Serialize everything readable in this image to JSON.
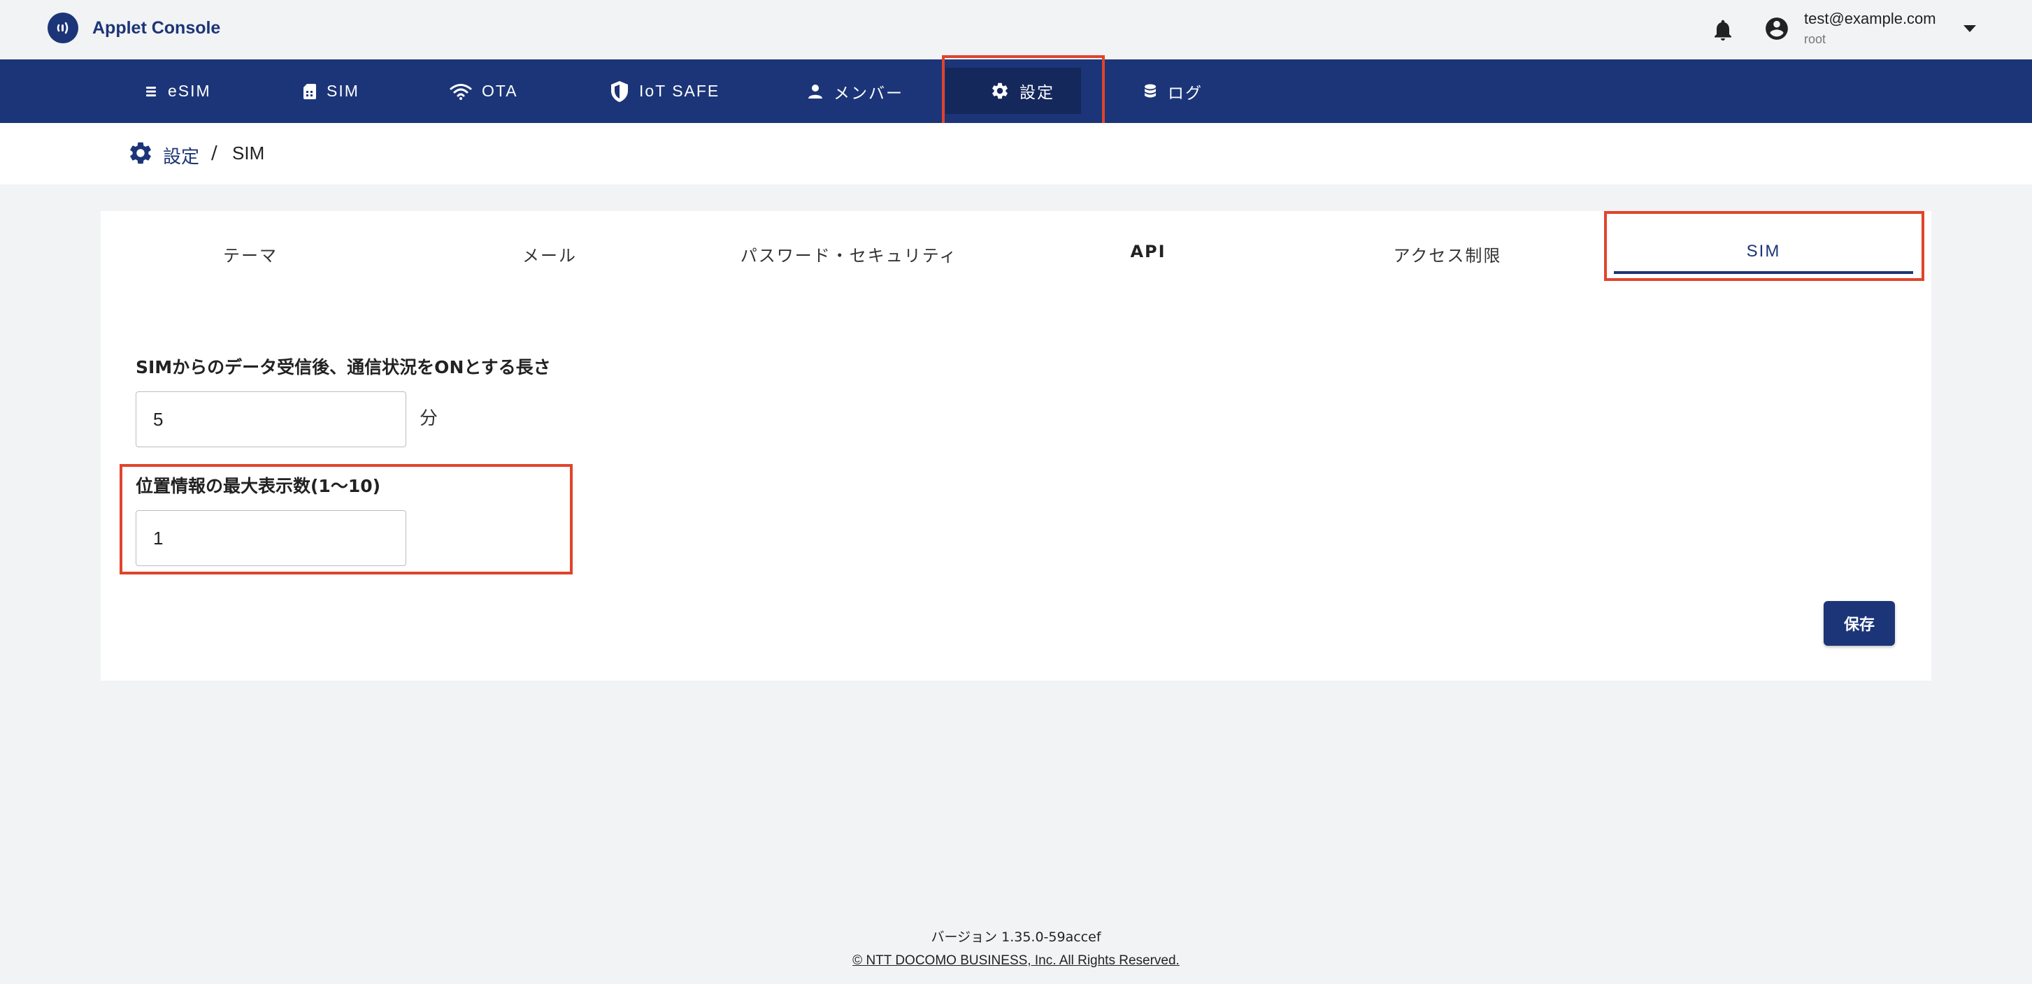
{
  "app": {
    "title": "Applet Console"
  },
  "account": {
    "email": "test@example.com",
    "role": "root"
  },
  "nav": {
    "items": [
      {
        "label": "eSIM",
        "icon": "esim-icon"
      },
      {
        "label": "SIM",
        "icon": "sim-card-icon"
      },
      {
        "label": "OTA",
        "icon": "wifi-icon"
      },
      {
        "label": "IoT SAFE",
        "icon": "shield-icon"
      },
      {
        "label": "メンバー",
        "icon": "person-icon"
      },
      {
        "label": "設定",
        "icon": "gear-icon",
        "active": true
      },
      {
        "label": "ログ",
        "icon": "database-icon"
      }
    ]
  },
  "breadcrumb": {
    "parent": "設定",
    "separator": "/",
    "current": "SIM"
  },
  "tabs": [
    {
      "label": "テーマ"
    },
    {
      "label": "メール"
    },
    {
      "label": "パスワード・セキュリティ"
    },
    {
      "label": "API"
    },
    {
      "label": "アクセス制限"
    },
    {
      "label": "SIM",
      "active": true
    }
  ],
  "form": {
    "online_duration": {
      "label": "SIMからのデータ受信後、通信状況をONとする長さ",
      "value": "5",
      "unit": "分"
    },
    "max_locations": {
      "label": "位置情報の最大表示数(1〜10)",
      "value": "1"
    },
    "save_label": "保存"
  },
  "footer": {
    "version": "バージョン 1.35.0-59accef",
    "copyright": "© NTT DOCOMO BUSINESS, Inc. All Rights Reserved."
  },
  "colors": {
    "primary": "#1c3578",
    "nav_active": "#14285c",
    "highlight": "#e0442b",
    "background": "#f2f3f5"
  }
}
